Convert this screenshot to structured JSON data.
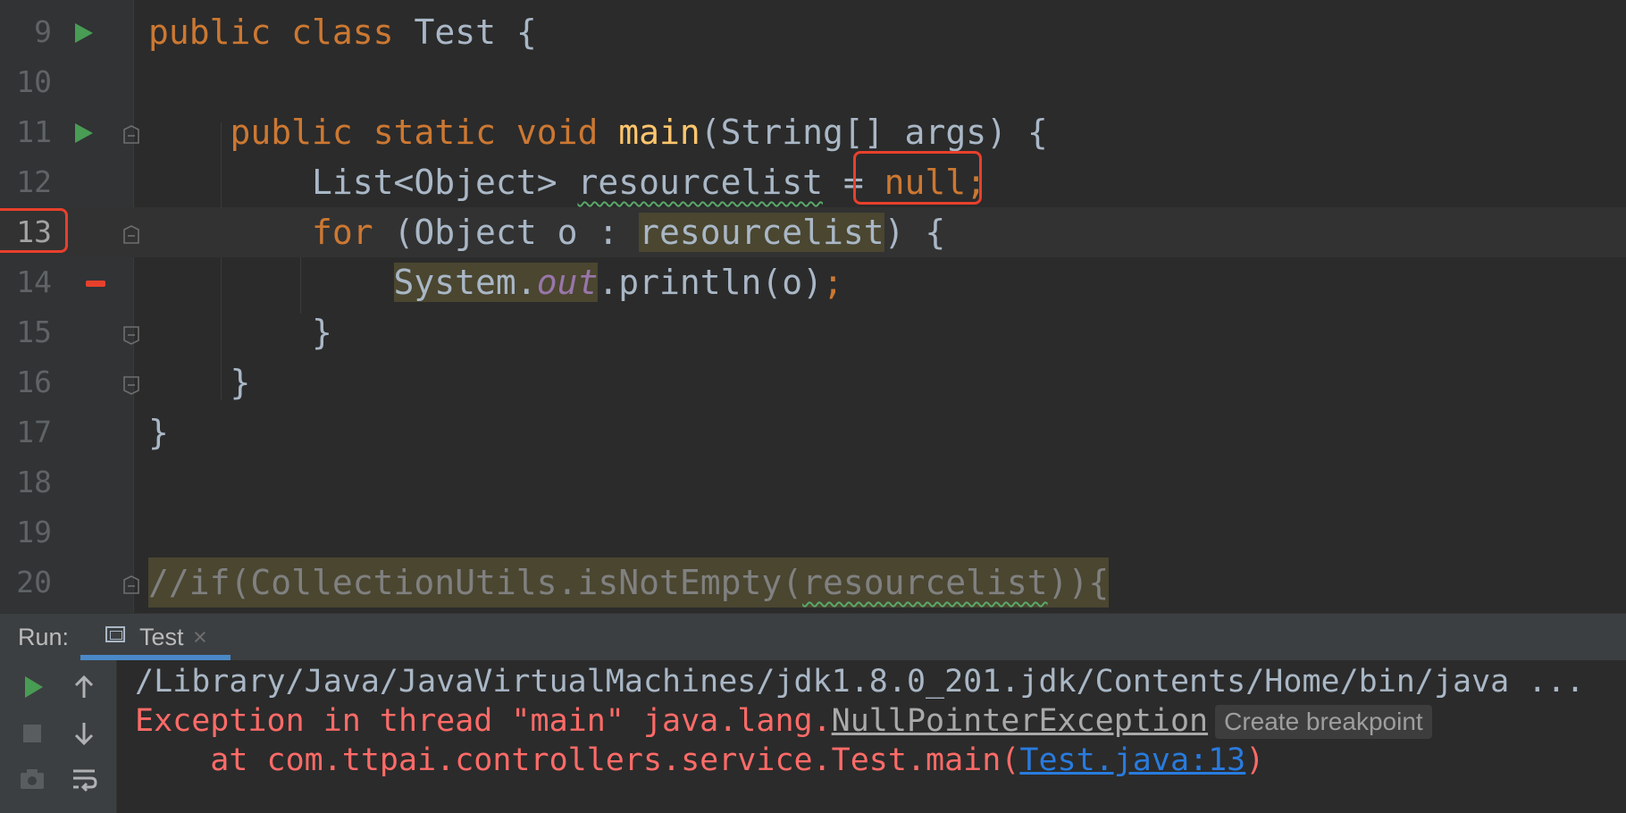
{
  "editor": {
    "lines": [
      {
        "num": "9",
        "code": {
          "k1": "public",
          "k2": "class",
          "name": "Test",
          "brace": "{"
        }
      },
      {
        "num": "10"
      },
      {
        "num": "11",
        "code": {
          "k1": "public",
          "k2": "static",
          "k3": "void",
          "fn": "main",
          "rest": "(String[] args) {"
        }
      },
      {
        "num": "12",
        "code": {
          "type": "List<Object> ",
          "var": "resourcelist",
          "eq": " = ",
          "null": "null;"
        }
      },
      {
        "num": "13",
        "code": {
          "k": "for",
          "mid": " (Object o : ",
          "var": "resourcelist",
          "end": ") {"
        }
      },
      {
        "num": "14",
        "code": {
          "sys": "System.",
          "out": "out",
          "call": ".println(o)",
          "semi": ";"
        }
      },
      {
        "num": "15",
        "code": {
          "brace": "}"
        }
      },
      {
        "num": "16",
        "code": {
          "brace": "}"
        }
      },
      {
        "num": "17",
        "code": {
          "brace": "}"
        }
      },
      {
        "num": "18"
      },
      {
        "num": "19"
      },
      {
        "num": "20",
        "code": {
          "pre": "//if(CollectionUtils.isNotEmpty(",
          "var": "resourcelist",
          "post": ")){"
        }
      }
    ]
  },
  "run_panel": {
    "title": "Run:",
    "tab_label": "Test",
    "tab_close": "×",
    "console": {
      "line1": "/Library/Java/JavaVirtualMachines/jdk1.8.0_201.jdk/Contents/Home/bin/java ...",
      "line2_prefix": "Exception in thread \"main\" java.lang.",
      "line2_exception": "NullPointerException",
      "hint": "Create breakpoint",
      "line3_prefix": "    at com.ttpai.controllers.service.Test.main(",
      "line3_link": "Test.java:13",
      "line3_suffix": ")"
    }
  },
  "colors": {
    "keyword": "#cc7832",
    "function": "#ffc66d",
    "field": "#9876aa",
    "error": "#ff6b68",
    "link": "#287bde",
    "annotation_box": "#e8402c"
  },
  "icons": [
    "run-gutter-icon",
    "fold-icon",
    "breakpoint-marker-icon",
    "console-tab-icon",
    "rerun-icon",
    "stop-icon",
    "scroll-up-icon",
    "scroll-down-icon",
    "snapshot-icon",
    "soft-wrap-icon"
  ]
}
